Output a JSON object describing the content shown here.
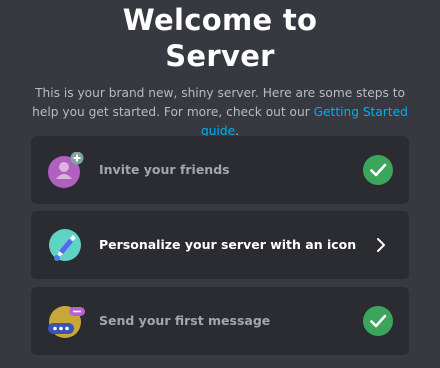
{
  "header": {
    "title_line1": "Welcome to",
    "title_line2": "Server",
    "subtitle_text": "This is your brand new, shiny server. Here are some steps to help you get started. For more, check out our ",
    "subtitle_link": "Getting Started guide",
    "subtitle_end": "."
  },
  "steps": [
    {
      "label": "Invite your friends",
      "status": "completed",
      "icon": "invite-friends-icon"
    },
    {
      "label": "Personalize your server with an icon",
      "status": "pending",
      "icon": "personalize-icon"
    },
    {
      "label": "Send your first message",
      "status": "completed",
      "icon": "message-icon"
    }
  ],
  "colors": {
    "background": "#36393f",
    "card": "#2a2c31",
    "link": "#00aff4",
    "success": "#3ba55c"
  }
}
